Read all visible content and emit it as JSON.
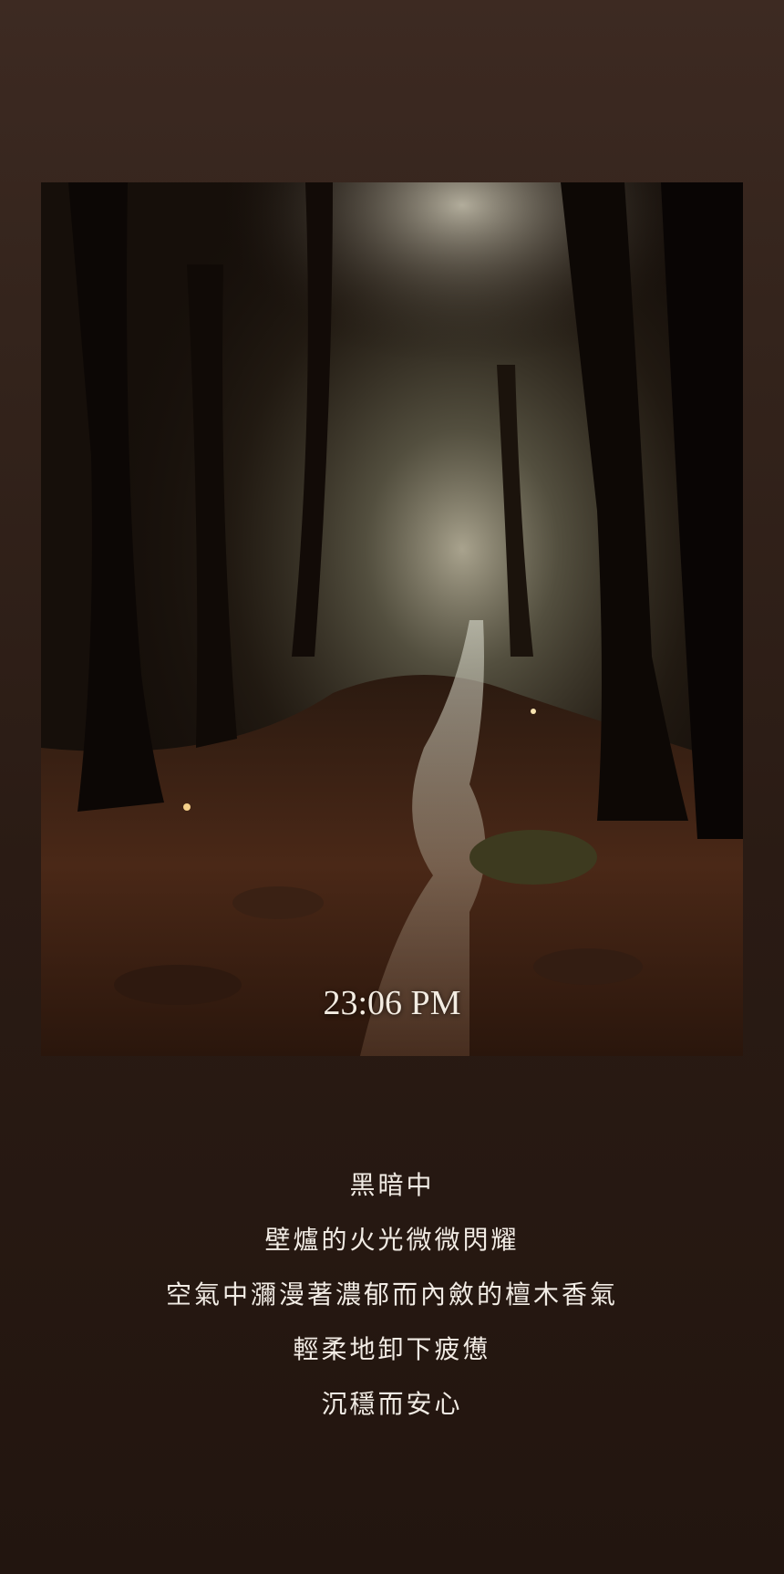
{
  "lockscreen": {
    "time": "23:06 PM",
    "artwork_description_icon": "forest-stream-artwork"
  },
  "poem": {
    "lines": [
      "黑暗中",
      "壁爐的火光微微閃耀",
      "空氣中瀰漫著濃郁而內斂的檀木香氣",
      "輕柔地卸下疲憊",
      "沉穩而安心"
    ]
  },
  "colors": {
    "background_top": "#3d2a22",
    "background_bottom": "#22150f",
    "text": "#f1ebe4"
  }
}
